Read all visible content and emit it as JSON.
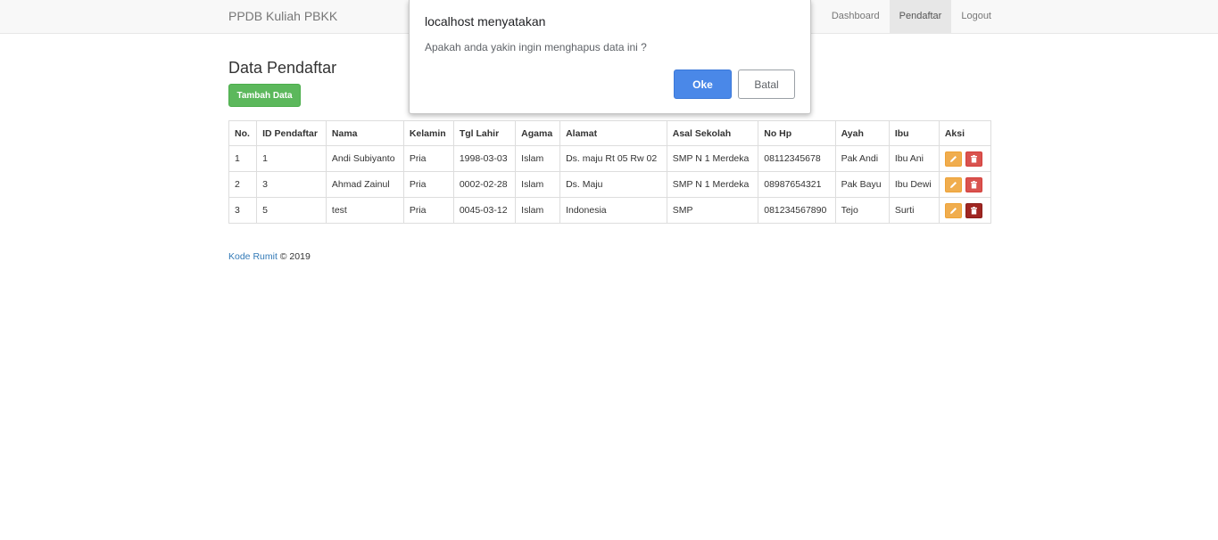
{
  "navbar": {
    "brand": "PPDB Kuliah PBKK",
    "links": [
      {
        "label": "Dashboard"
      },
      {
        "label": "Pendaftar"
      },
      {
        "label": "Logout"
      }
    ]
  },
  "main": {
    "title": "Data Pendaftar",
    "add_button": "Tambah Data"
  },
  "table": {
    "headers": [
      "No.",
      "ID Pendaftar",
      "Nama",
      "Kelamin",
      "Tgl Lahir",
      "Agama",
      "Alamat",
      "Asal Sekolah",
      "No Hp",
      "Ayah",
      "Ibu",
      "Aksi"
    ],
    "rows": [
      [
        "1",
        "1",
        "Andi Subiyanto",
        "Pria",
        "1998-03-03",
        "Islam",
        "Ds. maju Rt 05 Rw 02",
        "SMP N 1 Merdeka",
        "08112345678",
        "Pak Andi",
        "Ibu Ani"
      ],
      [
        "2",
        "3",
        "Ahmad Zainul",
        "Pria",
        "0002-02-28",
        "Islam",
        "Ds. Maju",
        "SMP N 1 Merdeka",
        "08987654321",
        "Pak Bayu",
        "Ibu Dewi"
      ],
      [
        "3",
        "5",
        "test",
        "Pria",
        "0045-03-12",
        "Islam",
        "Indonesia",
        "SMP",
        "081234567890",
        "Tejo",
        "Surti"
      ]
    ],
    "action_icons": [
      "pencil-icon",
      "trash-icon"
    ]
  },
  "footer": {
    "link": "Kode Rumit",
    "text": " © 2019"
  },
  "dialog": {
    "title": "localhost menyatakan",
    "message": "Apakah anda yakin ingin menghapus data ini ?",
    "ok": "Oke",
    "cancel": "Batal"
  },
  "colors": {
    "success": "#5cb85c",
    "warning": "#f0ad4e",
    "danger": "#d9534f",
    "link": "#337ab7",
    "dialog_ok": "#4a88e8"
  }
}
